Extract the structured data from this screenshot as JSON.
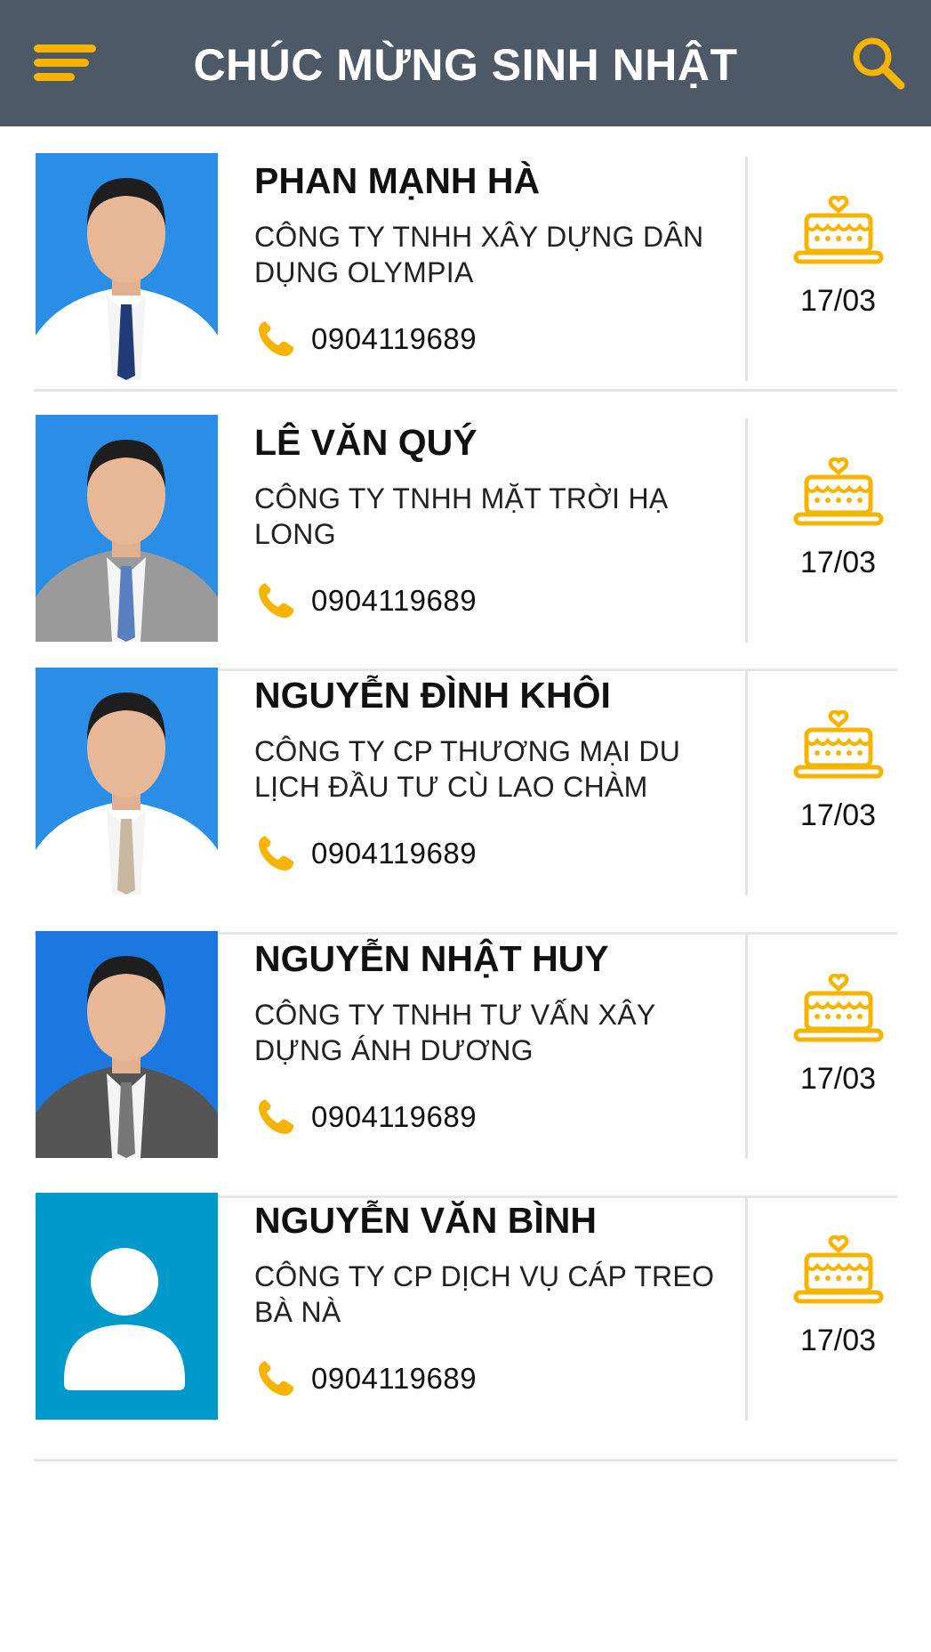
{
  "header": {
    "title": "CHÚC MỪNG SINH NHẬT",
    "menu_icon": "hamburger-menu-icon",
    "search_icon": "search-icon"
  },
  "colors": {
    "header_bg": "#4d5966",
    "accent": "#f4b400",
    "divider": "#e6e6e6"
  },
  "contacts": [
    {
      "name": "PHAN MẠNH HÀ",
      "company": "CÔNG TY TNHH XÂY DỰNG DÂN DỤNG OLYMPIA",
      "phone": "0904119689",
      "birthday": "17/03",
      "avatar": "person-photo"
    },
    {
      "name": "LÊ VĂN QUÝ",
      "company": "CÔNG TY TNHH MẶT TRỜI HẠ LONG",
      "phone": "0904119689",
      "birthday": "17/03",
      "avatar": "person-photo"
    },
    {
      "name": "NGUYỄN ĐÌNH KHÔI",
      "company": "CÔNG TY CP THƯƠNG MẠI DU LỊCH ĐẦU TƯ CÙ LAO CHÀM",
      "phone": "0904119689",
      "birthday": "17/03",
      "avatar": "person-photo"
    },
    {
      "name": "NGUYỄN NHẬT HUY",
      "company": "CÔNG TY TNHH TƯ VẤN XÂY DỰNG ÁNH DƯƠNG",
      "phone": "0904119689",
      "birthday": "17/03",
      "avatar": "person-photo"
    },
    {
      "name": "NGUYỄN VĂN BÌNH",
      "company": "CÔNG TY CP DỊCH VỤ CÁP TREO BÀ NÀ",
      "phone": "0904119689",
      "birthday": "17/03",
      "avatar": "default-user-placeholder"
    }
  ]
}
